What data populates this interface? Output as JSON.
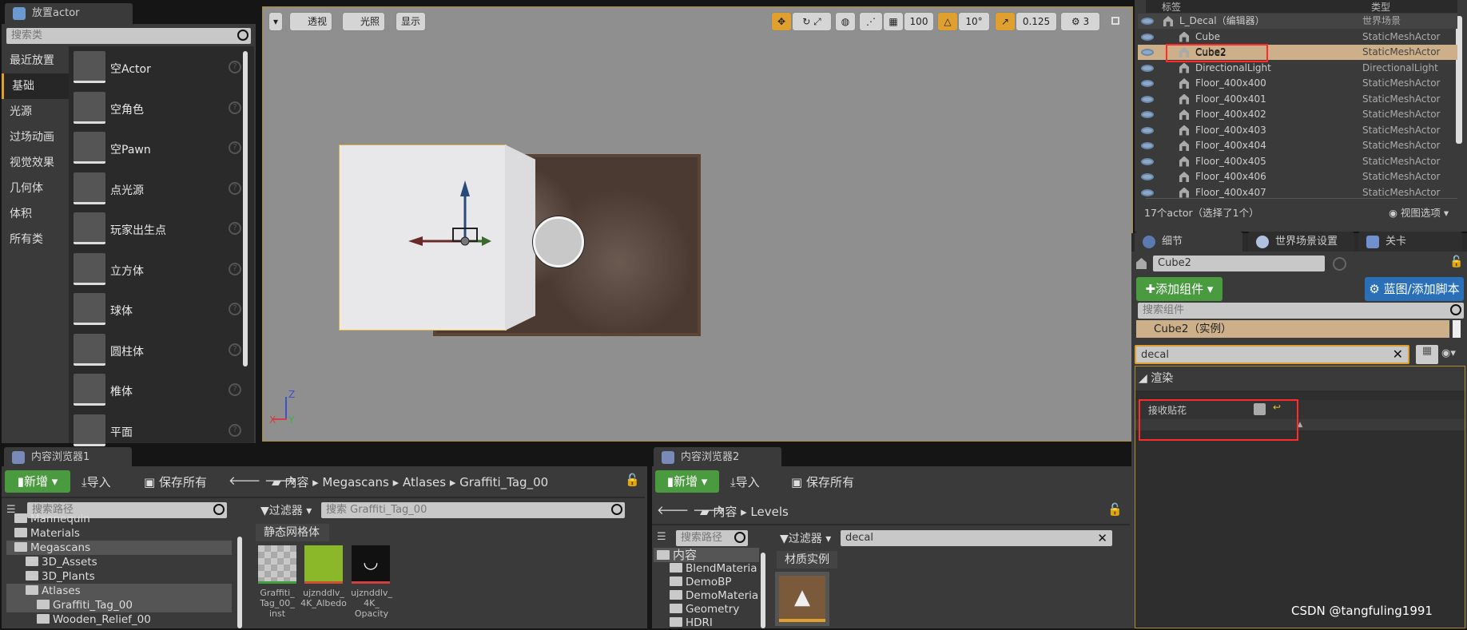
{
  "place_actor": {
    "tab": "放置actor",
    "search_placeholder": "搜索类",
    "categories": [
      "最近放置",
      "基础",
      "光源",
      "过场动画",
      "视觉效果",
      "几何体",
      "体积",
      "所有类"
    ],
    "selected_category": "基础",
    "items": [
      "空Actor",
      "空角色",
      "空Pawn",
      "点光源",
      "玩家出生点",
      "立方体",
      "球体",
      "圆柱体",
      "椎体",
      "平面"
    ]
  },
  "viewport": {
    "buttons": [
      "透视",
      "光照",
      "显示"
    ],
    "grid_snap": "100",
    "rot_snap": "10°",
    "scale_snap": "0.125",
    "camera_speed": "3",
    "axes": {
      "z": "Z",
      "x": "X",
      "y": "Y"
    }
  },
  "outliner": {
    "col_label": "标签",
    "col_type": "类型",
    "rows": [
      {
        "name": "L_Decal（编辑器）",
        "type": "世界场景"
      },
      {
        "name": "Cube",
        "type": "StaticMeshActor"
      },
      {
        "name": "Cube2",
        "type": "StaticMeshActor"
      },
      {
        "name": "DirectionalLight",
        "type": "DirectionalLight"
      },
      {
        "name": "Floor_400x400",
        "type": "StaticMeshActor"
      },
      {
        "name": "Floor_400x401",
        "type": "StaticMeshActor"
      },
      {
        "name": "Floor_400x402",
        "type": "StaticMeshActor"
      },
      {
        "name": "Floor_400x403",
        "type": "StaticMeshActor"
      },
      {
        "name": "Floor_400x404",
        "type": "StaticMeshActor"
      },
      {
        "name": "Floor_400x405",
        "type": "StaticMeshActor"
      },
      {
        "name": "Floor_400x406",
        "type": "StaticMeshActor"
      },
      {
        "name": "Floor_400x407",
        "type": "StaticMeshActor"
      }
    ],
    "selected": "Cube2",
    "status": "17个actor（选择了1个）",
    "view_options": "视图选项"
  },
  "details": {
    "tabs": [
      "细节",
      "世界场景设置",
      "关卡"
    ],
    "name": "Cube2",
    "add_component": "添加组件",
    "blueprint": "蓝图/添加脚本",
    "search_placeholder": "搜索组件",
    "instance": "Cube2（实例）",
    "filter": "decal",
    "section": "渲染",
    "property": "接收贴花",
    "property_checked": false
  },
  "cb1": {
    "tab": "内容浏览器1",
    "new": "新增",
    "import": "导入",
    "save_all": "保存所有",
    "path": [
      "内容",
      "Megascans",
      "Atlases",
      "Graffiti_Tag_00"
    ],
    "search_path_placeholder": "搜索路径",
    "filter": "过滤器",
    "search_placeholder": "搜索 Graffiti_Tag_00",
    "tree": [
      "Mannequin",
      "Materials",
      "Megascans",
      "3D_Assets",
      "3D_Plants",
      "Atlases",
      "Graffiti_Tag_00",
      "Wooden_Relief_00"
    ],
    "category": "静态网格体",
    "assets": [
      "Graffiti_ Tag_00_ inst",
      "ujznddlv_ 4K_Albedo",
      "ujznddlv_ 4K_ Opacity"
    ]
  },
  "cb2": {
    "tab": "内容浏览器2",
    "new": "新增",
    "import": "导入",
    "save_all": "保存所有",
    "path": [
      "内容",
      "Levels"
    ],
    "search_path_placeholder": "搜索路径",
    "filter": "过滤器",
    "search": "decal",
    "tree": [
      "内容",
      "BlendMateria",
      "DemoBP",
      "DemoMateria",
      "Geometry",
      "HDRI"
    ],
    "category": "材质实例"
  },
  "watermark": "CSDN @tangfuling1991",
  "colors": {
    "accent": "#e0a030",
    "green": "#4a9a40",
    "blue": "#2a70b8",
    "highlight": "#cdb08a",
    "annotation": "#ff2a2a"
  }
}
